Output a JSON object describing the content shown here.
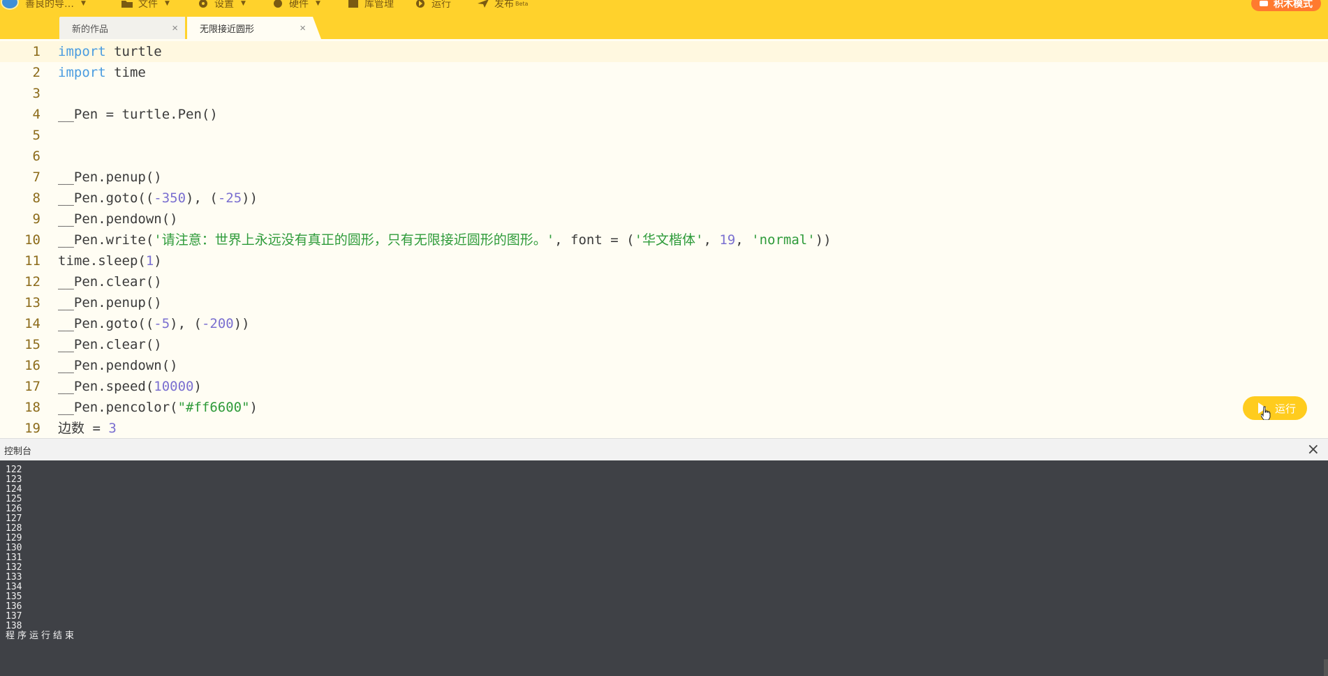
{
  "toolbar": {
    "app_name": "善良的导…",
    "menus": [
      "文件",
      "设置",
      "硬件",
      "库管理",
      "运行",
      "发布"
    ],
    "publish_badge": "Beta",
    "mode_label": "积木模式",
    "colors": {
      "bar": "#ffd22c",
      "mode_button": "#ff7a2f"
    }
  },
  "tabs": [
    {
      "label": "新的作品",
      "close": "×"
    },
    {
      "label": "无限接近圆形",
      "close": "×"
    }
  ],
  "editor": {
    "active_line": 1,
    "lines": [
      [
        [
          "kw",
          "import"
        ],
        [
          "def",
          " turtle"
        ]
      ],
      [
        [
          "kw",
          "import"
        ],
        [
          "def",
          " time"
        ]
      ],
      [],
      [
        [
          "def",
          "__Pen = turtle.Pen()"
        ]
      ],
      [],
      [],
      [
        [
          "def",
          "__Pen.penup()"
        ]
      ],
      [
        [
          "def",
          "__Pen.goto(("
        ],
        [
          "num",
          "-350"
        ],
        [
          "def",
          "), ("
        ],
        [
          "num",
          "-25"
        ],
        [
          "def",
          "))"
        ]
      ],
      [
        [
          "def",
          "__Pen.pendown()"
        ]
      ],
      [
        [
          "def",
          "__Pen.write("
        ],
        [
          "str",
          "'请注意：世界上永远没有真正的圆形，只有无限接近圆形的图形。'"
        ],
        [
          "def",
          ", font = ("
        ],
        [
          "str",
          "'华文楷体'"
        ],
        [
          "def",
          ", "
        ],
        [
          "num",
          "19"
        ],
        [
          "def",
          ", "
        ],
        [
          "str",
          "'normal'"
        ],
        [
          "def",
          "))"
        ]
      ],
      [
        [
          "def",
          "time.sleep("
        ],
        [
          "num",
          "1"
        ],
        [
          "def",
          ")"
        ]
      ],
      [
        [
          "def",
          "__Pen.clear()"
        ]
      ],
      [
        [
          "def",
          "__Pen.penup()"
        ]
      ],
      [
        [
          "def",
          "__Pen.goto(("
        ],
        [
          "num",
          "-5"
        ],
        [
          "def",
          "), ("
        ],
        [
          "num",
          "-200"
        ],
        [
          "def",
          "))"
        ]
      ],
      [
        [
          "def",
          "__Pen.clear()"
        ]
      ],
      [
        [
          "def",
          "__Pen.pendown()"
        ]
      ],
      [
        [
          "def",
          "__Pen.speed("
        ],
        [
          "num",
          "10000"
        ],
        [
          "def",
          ")"
        ]
      ],
      [
        [
          "def",
          "__Pen.pencolor("
        ],
        [
          "str",
          "\"#ff6600\""
        ],
        [
          "def",
          ")"
        ]
      ],
      [
        [
          "def",
          "边数 = "
        ],
        [
          "num",
          "3"
        ]
      ]
    ]
  },
  "run_button": {
    "label": "运行"
  },
  "console": {
    "title": "控制台",
    "close": "×",
    "output": [
      "122",
      "123",
      "124",
      "125",
      "126",
      "127",
      "128",
      "129",
      "130",
      "131",
      "132",
      "133",
      "134",
      "135",
      "136",
      "137",
      "138"
    ],
    "end_message": "程序运行结束"
  }
}
